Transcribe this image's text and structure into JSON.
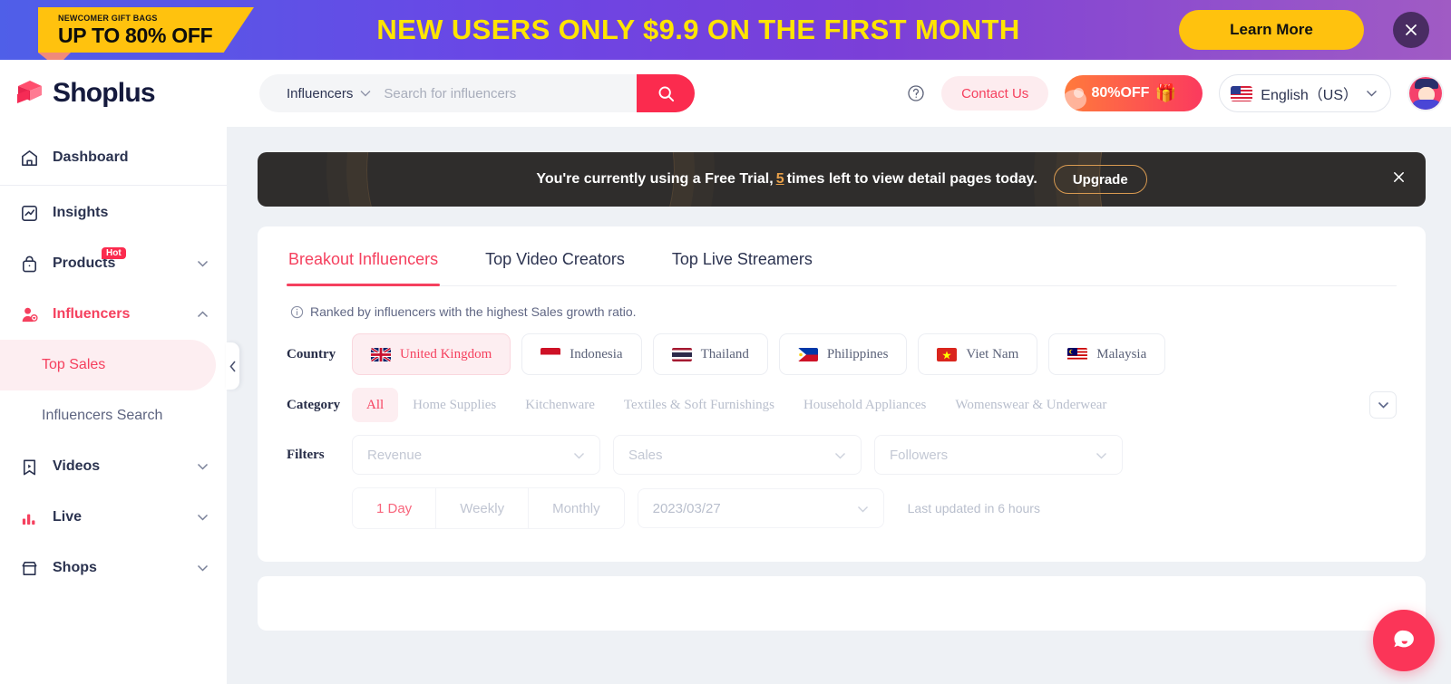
{
  "promo": {
    "badge_small": "NEWCOMER GIFT BAGS",
    "badge_big": "UP TO 80% OFF",
    "title": "NEW USERS ONLY $9.9 ON  THE FIRST MONTH",
    "learn_more": "Learn More",
    "close_icon": "close-icon"
  },
  "header": {
    "logo_text": "Shoplus",
    "search_category": "Influencers",
    "search_placeholder": "Search for influencers",
    "search_value": "",
    "help_icon": "help-circle-icon",
    "contact_us": "Contact Us",
    "offer_label": "80%OFF",
    "gift_icon": "gift-icon",
    "language": "English（US）",
    "avatar": "user-avatar"
  },
  "sidebar": {
    "items": [
      {
        "label": "Dashboard",
        "icon": "home-icon",
        "expandable": false,
        "active": false
      },
      {
        "label": "Insights",
        "icon": "insights-chart-icon",
        "expandable": false,
        "active": false
      },
      {
        "label": "Products",
        "icon": "bag-icon",
        "expandable": true,
        "active": false,
        "badge": "Hot"
      },
      {
        "label": "Influencers",
        "icon": "influencer-person-icon",
        "expandable": true,
        "active": true,
        "expanded": true
      },
      {
        "label": "Videos",
        "icon": "video-bookmark-icon",
        "expandable": true,
        "active": false
      },
      {
        "label": "Live",
        "icon": "live-bars-icon",
        "expandable": true,
        "active": false
      },
      {
        "label": "Shops",
        "icon": "shop-icon",
        "expandable": true,
        "active": false
      }
    ],
    "sub_items": [
      {
        "label": "Top Sales",
        "active": true
      },
      {
        "label": "Influencers Search",
        "active": false
      }
    ],
    "collapse_icon": "chevron-left-icon"
  },
  "trial_banner": {
    "text_before": "You're currently using a Free Trial,",
    "count": "5",
    "text_after": "times left to view detail pages today.",
    "upgrade_label": "Upgrade",
    "close_icon": "close-icon"
  },
  "main": {
    "tabs": [
      {
        "label": "Breakout Influencers",
        "active": true
      },
      {
        "label": "Top Video Creators",
        "active": false
      },
      {
        "label": "Top Live Streamers",
        "active": false
      }
    ],
    "note": "Ranked by influencers with the highest Sales growth ratio.",
    "note_icon": "info-icon",
    "country": {
      "label": "Country",
      "options": [
        {
          "label": "United Kingdom",
          "flag": "gb",
          "active": true
        },
        {
          "label": "Indonesia",
          "flag": "id",
          "active": false
        },
        {
          "label": "Thailand",
          "flag": "th",
          "active": false
        },
        {
          "label": "Philippines",
          "flag": "ph",
          "active": false
        },
        {
          "label": "Viet Nam",
          "flag": "vn",
          "active": false
        },
        {
          "label": "Malaysia",
          "flag": "my",
          "active": false
        }
      ]
    },
    "category": {
      "label": "Category",
      "options": [
        {
          "label": "All",
          "active": true
        },
        {
          "label": "Home Supplies",
          "active": false
        },
        {
          "label": "Kitchenware",
          "active": false
        },
        {
          "label": "Textiles & Soft Furnishings",
          "active": false
        },
        {
          "label": "Household Appliances",
          "active": false
        },
        {
          "label": "Womenswear & Underwear",
          "active": false
        }
      ],
      "expand_icon": "chevron-down-icon"
    },
    "filters": {
      "label": "Filters",
      "selects": [
        {
          "placeholder": "Revenue",
          "value": ""
        },
        {
          "placeholder": "Sales",
          "value": ""
        },
        {
          "placeholder": "Followers",
          "value": ""
        }
      ]
    },
    "period": {
      "segments": [
        {
          "label": "1 Day",
          "active": true
        },
        {
          "label": "Weekly",
          "active": false
        },
        {
          "label": "Monthly",
          "active": false
        }
      ],
      "date_value": "2023/03/27",
      "updated_text": "Last updated in 6 hours"
    }
  },
  "chat": {
    "icon": "chat-bubble-icon"
  },
  "colors": {
    "accent": "#f5405e",
    "promo_yellow": "#ffc20e",
    "promo_title": "#ffe500",
    "dark_navy": "#2b3350"
  }
}
